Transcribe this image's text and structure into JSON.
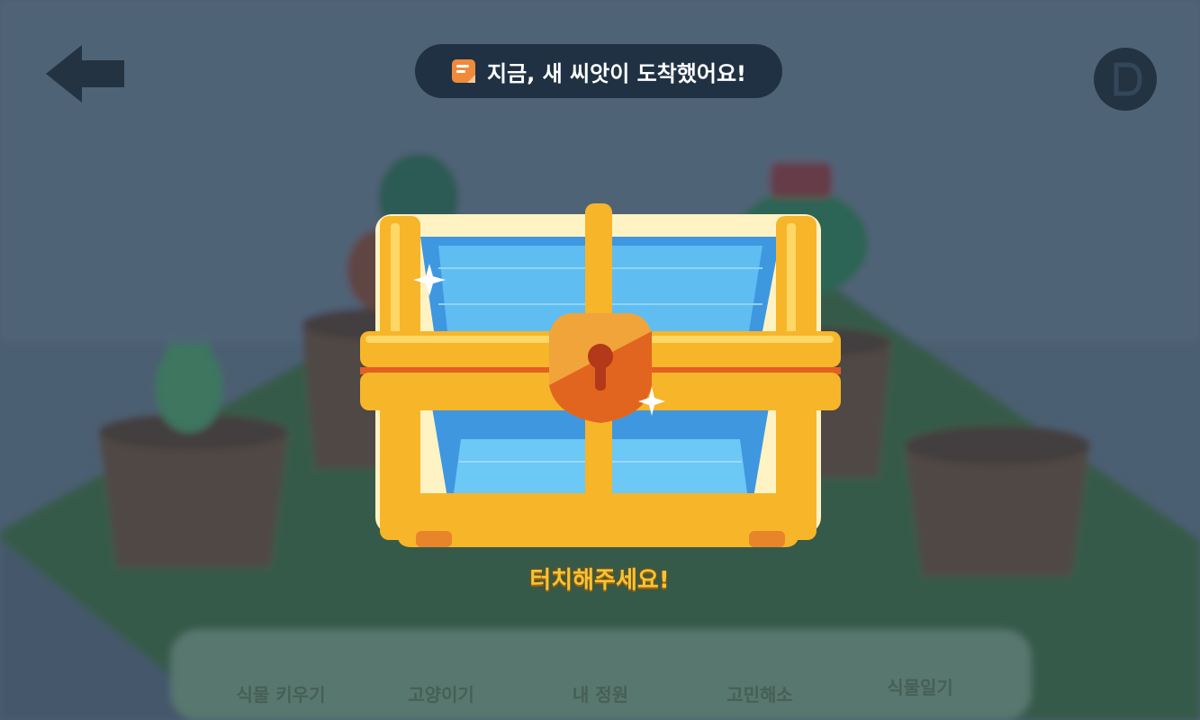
{
  "toast": {
    "icon": "memo-icon",
    "text": "지금, 새 씨앗이 도착했어요!"
  },
  "chest": {
    "prompt": "터치해주세요!"
  },
  "header": {
    "back_icon": "back-arrow-icon",
    "right_icon": "menu-circle-icon"
  },
  "bottom_nav": {
    "items": [
      {
        "label": "식물 키우기",
        "icon": "plant-pot-icon"
      },
      {
        "label": "고양이기",
        "icon": "watering-icon"
      },
      {
        "label": "내 정원",
        "icon": "garden-icon"
      },
      {
        "label": "고민해소",
        "icon": "person-icon"
      },
      {
        "label": "식물일기",
        "icon": "diary-icon"
      }
    ]
  },
  "colors": {
    "overlay": "#2c3e50",
    "toast_bg": "#1f3143",
    "chest_gold": "#f7b52a",
    "chest_blue": "#4aa3e8",
    "prompt": "#f4c534"
  }
}
